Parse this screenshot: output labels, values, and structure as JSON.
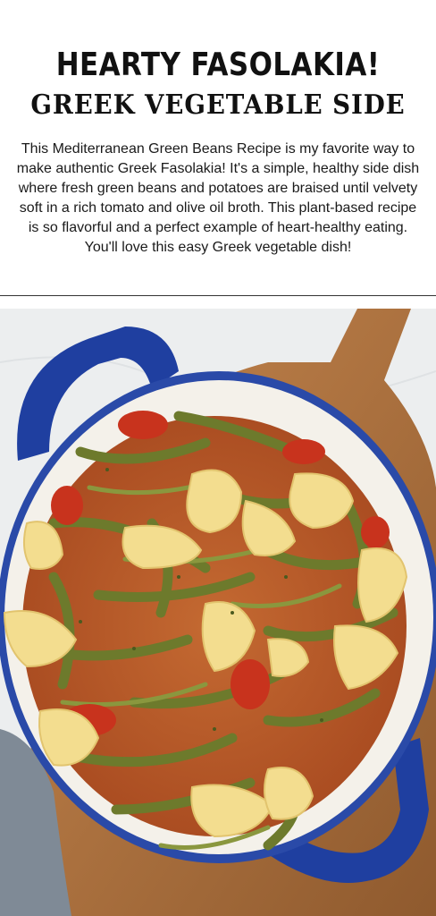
{
  "header": {
    "title_line1": "HEARTY FASOLAKIA!",
    "title_line2": "GREEK VEGETABLE SIDE",
    "description": "This Mediterranean Green Beans Recipe is my favorite way to make authentic Greek Fasolakia! It's a simple, healthy side dish where fresh green beans and potatoes are braised until velvety soft in a rich tomato and olive oil broth. This plant-based recipe is so flavorful and a perfect example of heart-healthy eating. You'll love this easy Greek vegetable dish!"
  },
  "photo": {
    "subject": "green-beans-potatoes-tomato-pot-icon",
    "colors": {
      "pot_handle": "#1f3fa0",
      "pot_enamel": "#f4f1ea",
      "board": "#b87a45",
      "sauce": "#c9662e",
      "beans": "#6d7a2c",
      "potato": "#f3dd8f",
      "tomato": "#c8331d",
      "towel": "#7f8a96",
      "marble": "#eef0f1"
    }
  }
}
